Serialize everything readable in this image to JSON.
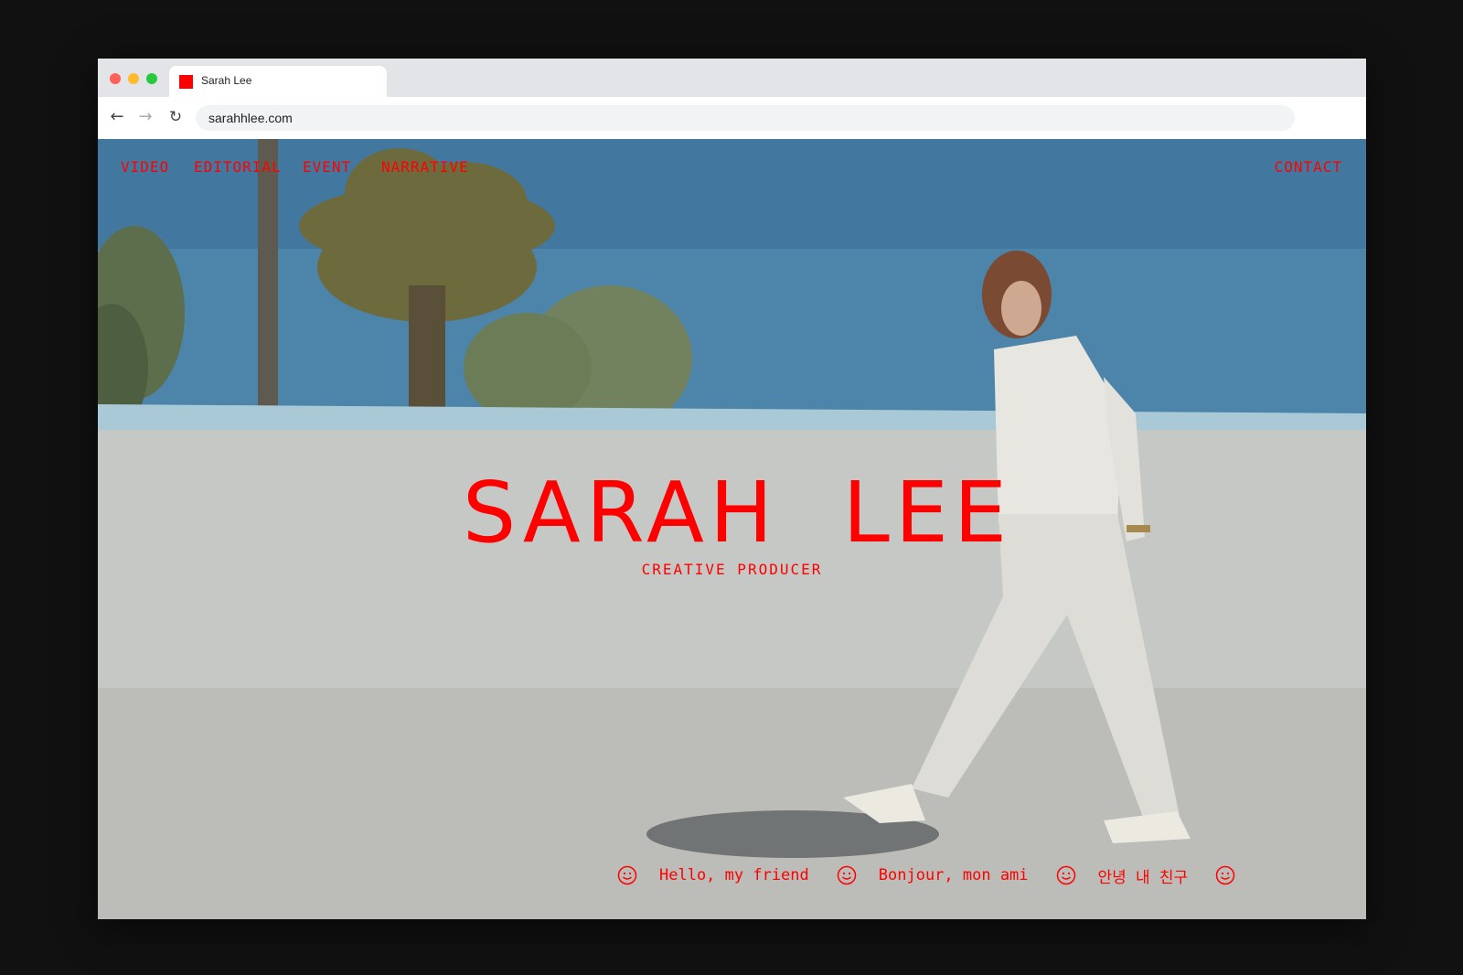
{
  "browser": {
    "tab_title": "Sarah Lee",
    "url": "sarahhlee.com",
    "favicon_color": "#ff0000"
  },
  "nav": {
    "items": [
      {
        "label": "VIDEO"
      },
      {
        "label": "EDITORIAL"
      },
      {
        "label": "EVENT"
      },
      {
        "label": "NARRATIVE"
      }
    ],
    "contact": "CONTACT"
  },
  "hero": {
    "name": "SARAH  LEE",
    "role": "CREATIVE PRODUCER",
    "accent_color": "#ff0000",
    "greetings": [
      "Hello, my friend",
      "Bonjour, mon ami",
      "안녕 내 친구"
    ],
    "icon": "smiley-icon"
  }
}
